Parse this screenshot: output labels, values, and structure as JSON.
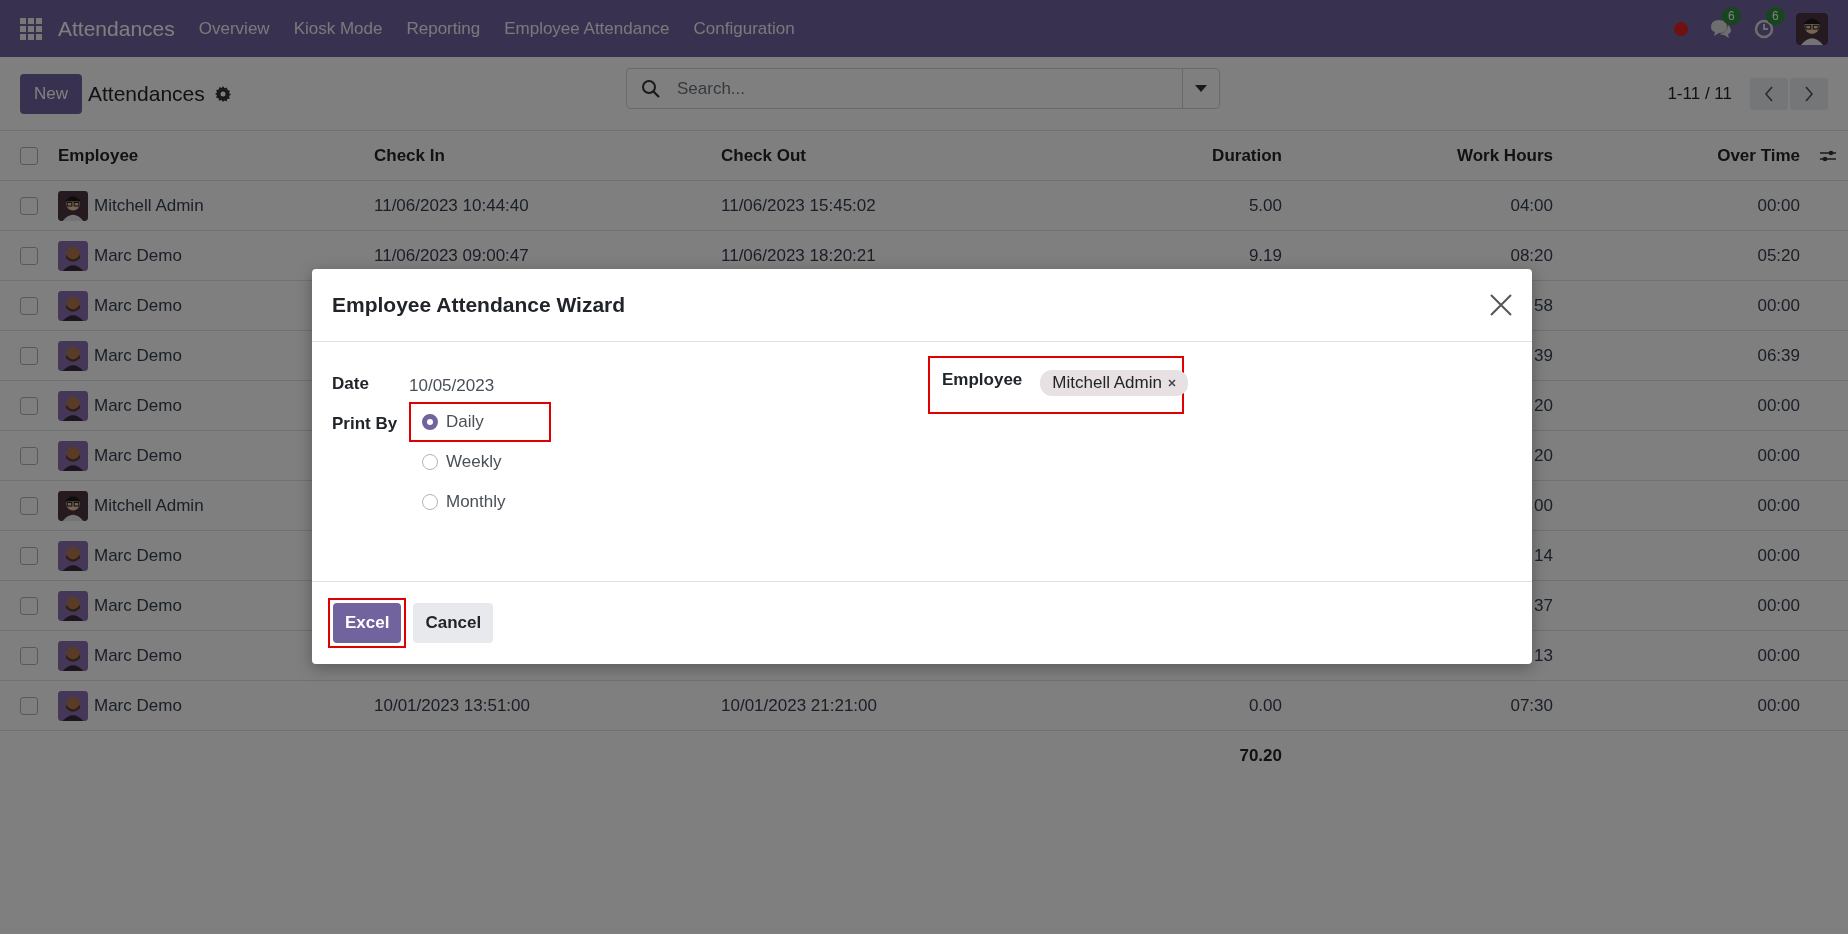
{
  "navbar": {
    "app_name": "Attendances",
    "menu": [
      "Overview",
      "Kiosk Mode",
      "Reporting",
      "Employee Attendance",
      "Configuration"
    ],
    "messages_badge": "6",
    "activities_badge": "6"
  },
  "control_panel": {
    "new_button": "New",
    "title": "Attendances",
    "search": {
      "placeholder": "Search..."
    },
    "pager": "1-11 / 11"
  },
  "table": {
    "columns": [
      "Employee",
      "Check In",
      "Check Out",
      "Duration",
      "Work Hours",
      "Over Time"
    ],
    "all_checked": false,
    "rows": [
      {
        "kind": "glasses",
        "checked": false,
        "employee": "Mitchell Admin",
        "check_in": "11/06/2023 10:44:40",
        "check_out": "11/06/2023 15:45:02",
        "duration": "5.00",
        "work_hours": "04:00",
        "over_time": "00:00"
      },
      {
        "kind": "beard",
        "checked": false,
        "employee": "Marc Demo",
        "check_in": "11/06/2023 09:00:47",
        "check_out": "11/06/2023 18:20:21",
        "duration": "9.19",
        "work_hours": "08:20",
        "over_time": "05:20"
      },
      {
        "kind": "beard",
        "checked": false,
        "employee": "Marc Demo",
        "work_hours": "58",
        "over_time": "00:00"
      },
      {
        "kind": "beard",
        "checked": false,
        "employee": "Marc Demo",
        "work_hours": "39",
        "over_time": "06:39"
      },
      {
        "kind": "beard",
        "checked": false,
        "employee": "Marc Demo",
        "work_hours": "20",
        "over_time": "00:00"
      },
      {
        "kind": "beard",
        "checked": false,
        "employee": "Marc Demo",
        "work_hours": "20",
        "over_time": "00:00"
      },
      {
        "kind": "glasses",
        "checked": false,
        "employee": "Mitchell Admin",
        "work_hours": "00",
        "over_time": "00:00"
      },
      {
        "kind": "beard",
        "checked": false,
        "employee": "Marc Demo",
        "work_hours": "14",
        "over_time": "00:00"
      },
      {
        "kind": "beard",
        "checked": false,
        "employee": "Marc Demo",
        "work_hours": "37",
        "over_time": "00:00"
      },
      {
        "kind": "beard",
        "checked": false,
        "employee": "Marc Demo",
        "work_hours": "13",
        "over_time": "00:00"
      },
      {
        "kind": "beard",
        "checked": false,
        "employee": "Marc Demo",
        "check_in": "10/01/2023 13:51:00",
        "check_out": "10/01/2023 21:21:00",
        "duration": "0.00",
        "work_hours": "07:30",
        "over_time": "00:00"
      }
    ],
    "total_duration": "70.20"
  },
  "dialog": {
    "title": "Employee Attendance Wizard",
    "date_label": "Date",
    "date_value": "10/05/2023",
    "print_by_label": "Print By",
    "options": [
      {
        "label": "Daily",
        "selected": true,
        "highlighted": true
      },
      {
        "label": "Weekly",
        "selected": false,
        "highlighted": false
      },
      {
        "label": "Monthly",
        "selected": false,
        "highlighted": false
      }
    ],
    "employee_label": "Employee",
    "employee_tags": [
      "Mitchell Admin"
    ],
    "employee_highlighted": true,
    "buttons": [
      {
        "label": "Excel",
        "kind": "primary",
        "highlighted": true
      },
      {
        "label": "Cancel",
        "kind": "secondary",
        "highlighted": false
      }
    ]
  }
}
